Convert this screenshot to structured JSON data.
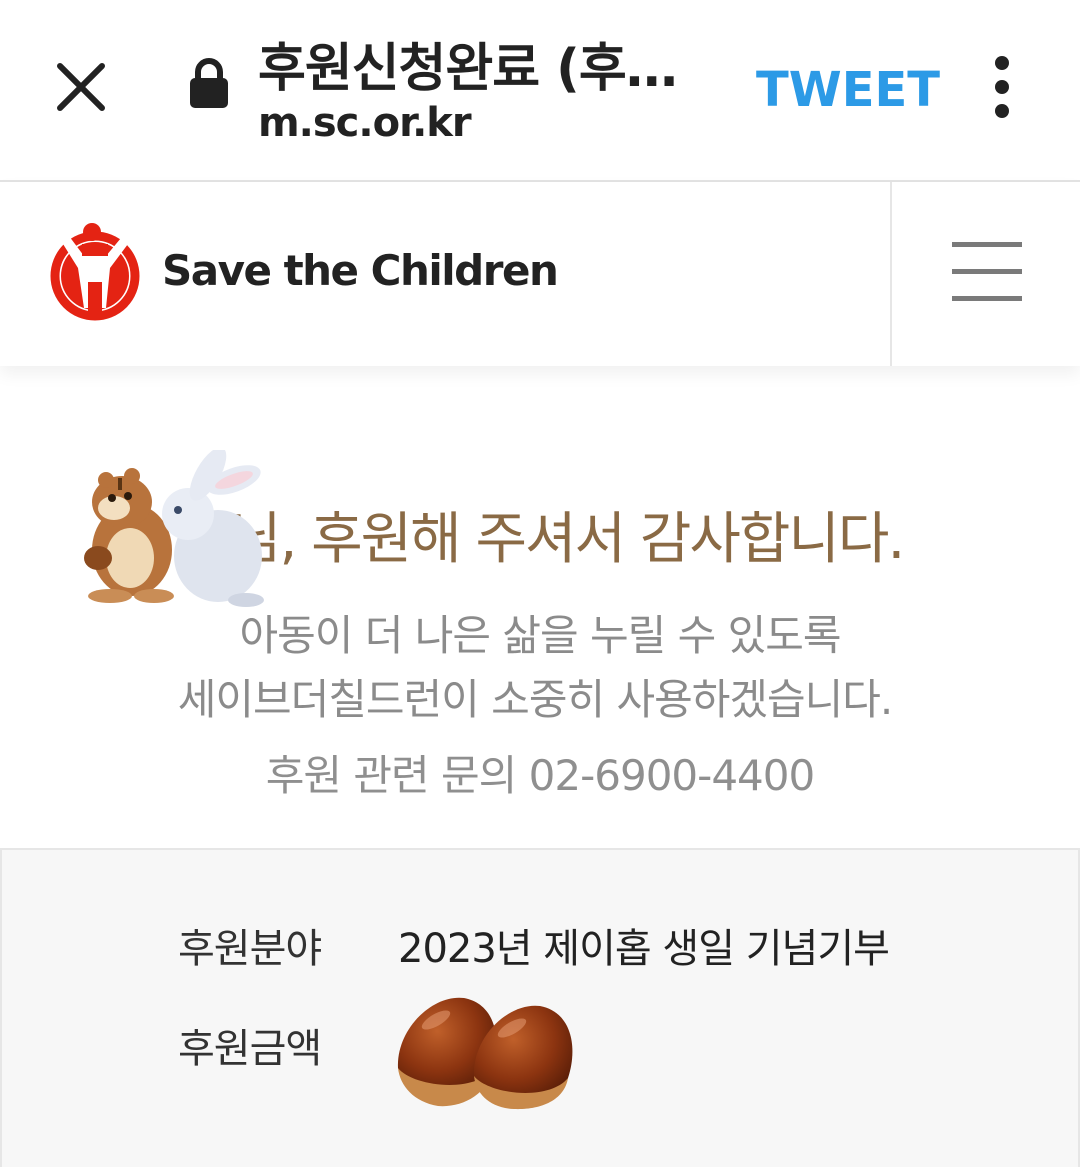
{
  "browser": {
    "title": "후원신청완료 (후…",
    "url": "m.sc.or.kr",
    "tweet_label": "TWEET",
    "icons": [
      "close-icon",
      "lock-icon",
      "kebab-menu-icon"
    ]
  },
  "header": {
    "logo_text": "Save the Children",
    "brand_color": "#e42313",
    "menu_icon": "hamburger-icon"
  },
  "thanks": {
    "title": "님, 후원해 주셔서 감사합니다.",
    "line1": "아동이 더 나은 삶을 누릴 수 있도록",
    "line2": "세이브더칠드런이 소중히 사용하겠습니다.",
    "contact": "후원 관련 문의 02-6900-4400",
    "title_color": "#8a6a45"
  },
  "details": {
    "field_label": "후원분야",
    "field_value": "2023년 제이홉 생일 기념기부",
    "amount_label": "후원금액",
    "amount_icon": "chestnut-emoji-icon"
  }
}
